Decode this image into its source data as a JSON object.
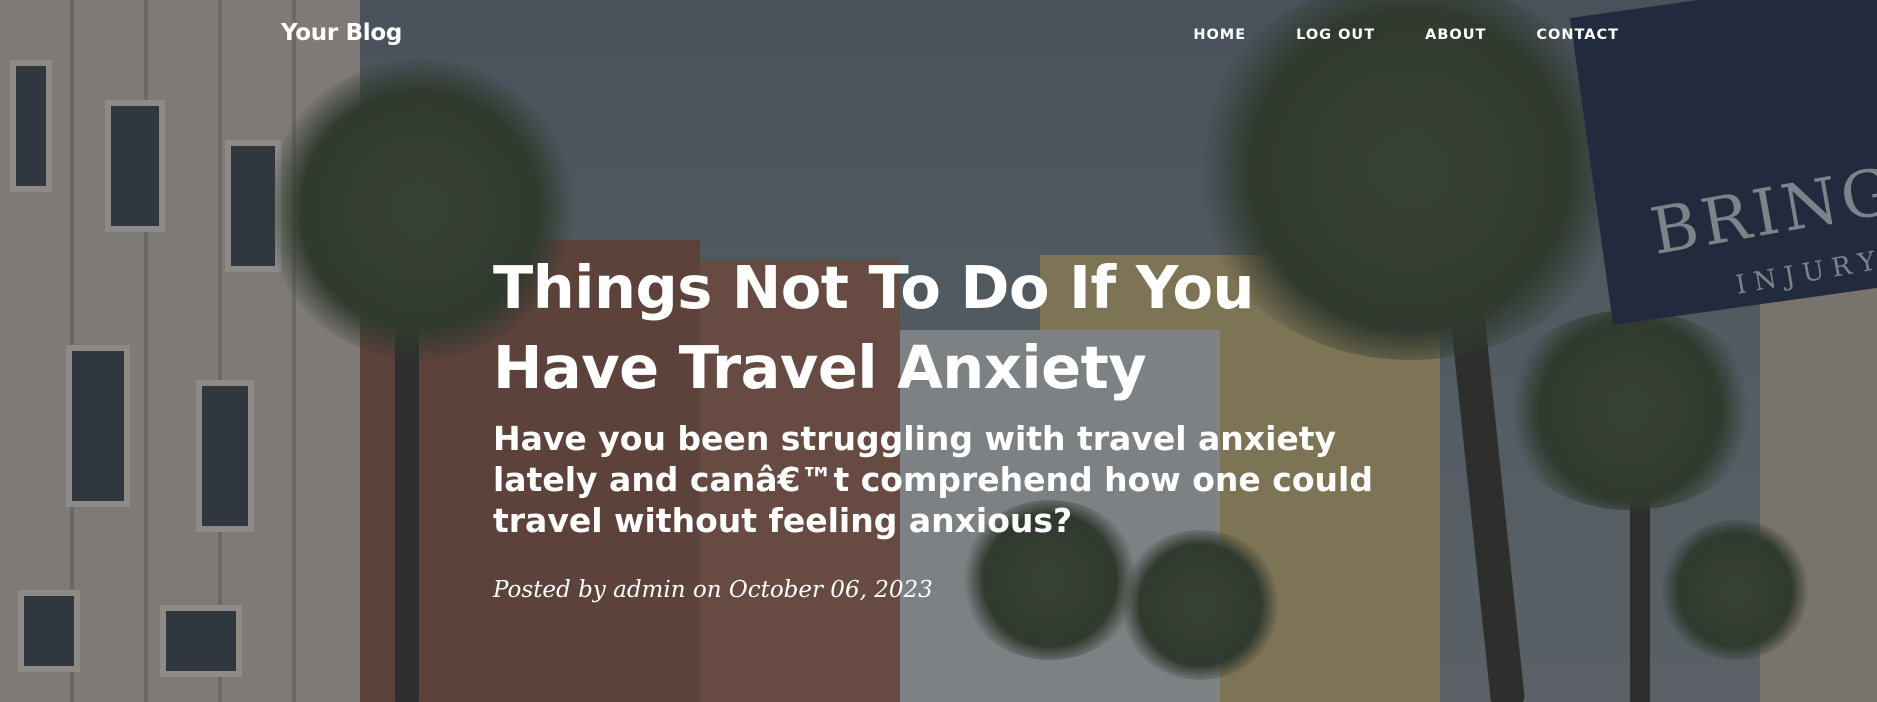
{
  "nav": {
    "brand": "Your Blog",
    "links": [
      {
        "label": "Home"
      },
      {
        "label": "Log Out"
      },
      {
        "label": "About"
      },
      {
        "label": "Contact"
      }
    ]
  },
  "post": {
    "title": "Things Not To Do If You Have Travel Anxiety",
    "subtitle": "Have you been struggling with travel anxiety lately and canâ€™t comprehend how one could travel without feeling anxious?",
    "meta_prefix": "Posted by",
    "author": "admin",
    "meta_on": "on",
    "date": "October 06, 2023"
  },
  "background": {
    "sign_text": "BRING",
    "sign_subtext": "INJURY"
  },
  "colors": {
    "text": "#ffffff",
    "overlay": "#212529",
    "sign": "#22314f"
  }
}
